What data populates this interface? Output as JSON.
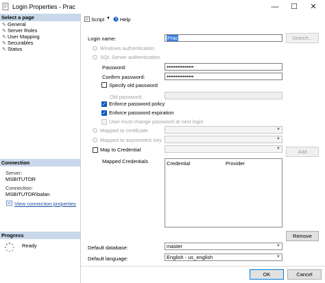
{
  "window": {
    "title": "Login Properties - Prac",
    "minimize_glyph": "—",
    "maximize_glyph": "☐",
    "close_glyph": "✕"
  },
  "select_page": {
    "header": "Select a page",
    "items": [
      "General",
      "Server Roles",
      "User Mapping",
      "Securables",
      "Status"
    ]
  },
  "connection": {
    "header": "Connection",
    "server_label": "Server:",
    "server_value": "MSBITUTOR",
    "connection_label": "Connection:",
    "connection_value": "MSBITUTOR\\balan",
    "view_link": "View connection properties"
  },
  "progress": {
    "header": "Progress",
    "status": "Ready"
  },
  "toolbar": {
    "script_label": "Script",
    "help_label": "Help"
  },
  "general": {
    "login_name_label": "Login name:",
    "login_name_value": "Prac",
    "search_label": "Search...",
    "windows_auth_label": "Windows authentication",
    "sql_auth_label": "SQL Server authentication",
    "password_label": "Password:",
    "password_value": "•••••••••••••••",
    "confirm_label": "Confirm password:",
    "confirm_value": "•••••••••••••••",
    "specify_old_label": "Specify old password",
    "old_password_label": "Old password:",
    "enforce_policy_label": "Enforce password policy",
    "enforce_policy_checked": true,
    "enforce_expiration_label": "Enforce password expiration",
    "enforce_expiration_checked": true,
    "must_change_label": "User must change password at next login",
    "mapped_cert_label": "Mapped to certificate",
    "mapped_key_label": "Mapped to asymmetric key",
    "map_credential_label": "Map to Credential",
    "add_label": "Add",
    "mapped_credentials_label": "Mapped Credentials",
    "credentials_columns": [
      "Credential",
      "Provider"
    ],
    "remove_label": "Remove",
    "default_db_label": "Default database:",
    "default_db_value": "master",
    "default_lang_label": "Default language:",
    "default_lang_value": "English - us_english"
  },
  "footer": {
    "ok_label": "OK",
    "cancel_label": "Cancel"
  }
}
